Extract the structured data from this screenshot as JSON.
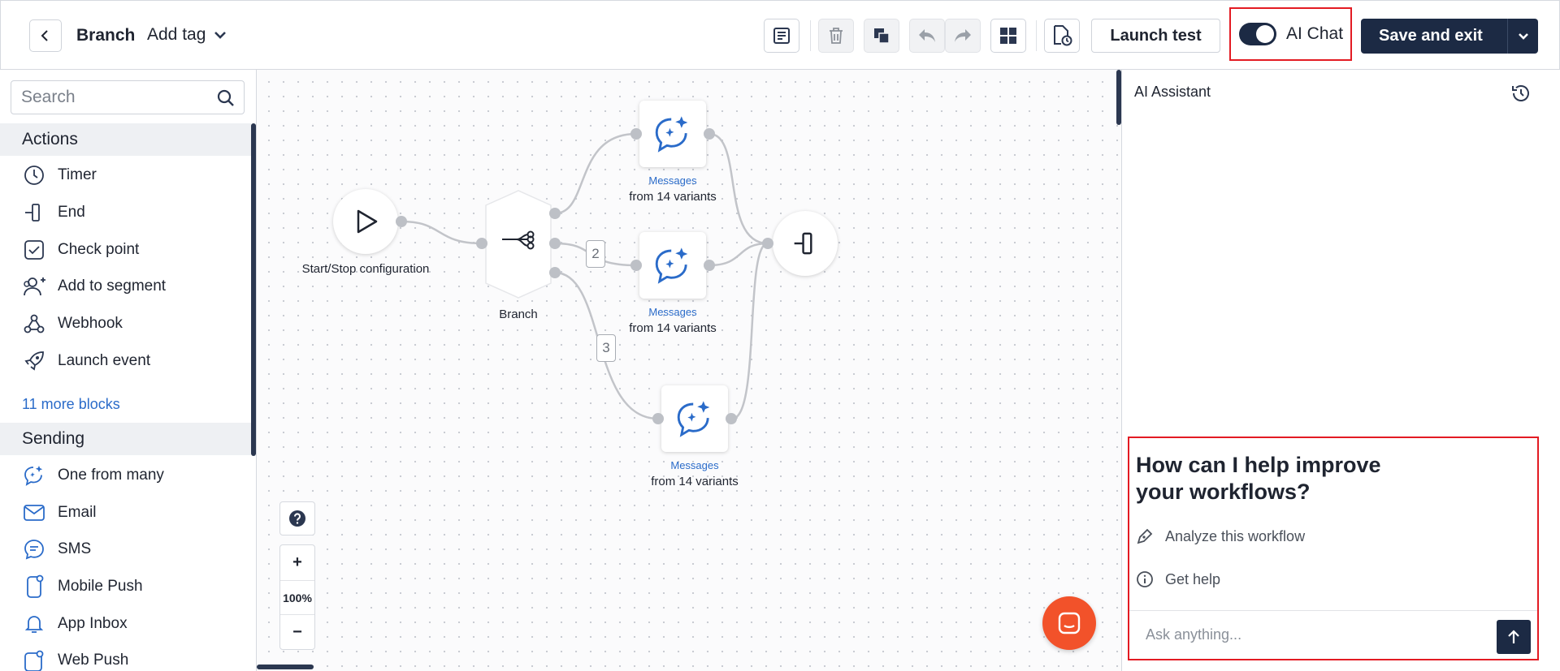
{
  "header": {
    "workflow_name": "Branch",
    "add_tag_label": "Add tag",
    "launch_test_label": "Launch test",
    "ai_chat_label": "AI Chat",
    "save_exit_label": "Save and exit",
    "ai_chat_enabled": true
  },
  "sidebar": {
    "search_placeholder": "Search",
    "sections": [
      {
        "title": "Actions",
        "items": [
          {
            "label": "Timer",
            "icon": "timer-icon"
          },
          {
            "label": "End",
            "icon": "end-icon"
          },
          {
            "label": "Check point",
            "icon": "checkpoint-icon"
          },
          {
            "label": "Add to segment",
            "icon": "add-segment-icon"
          },
          {
            "label": "Webhook",
            "icon": "webhook-icon"
          },
          {
            "label": "Launch event",
            "icon": "launch-event-icon"
          }
        ],
        "more_link": "11 more blocks"
      },
      {
        "title": "Sending",
        "items": [
          {
            "label": "One from many",
            "icon": "sparkle-chat-icon"
          },
          {
            "label": "Email",
            "icon": "email-icon"
          },
          {
            "label": "SMS",
            "icon": "sms-icon"
          },
          {
            "label": "Mobile Push",
            "icon": "mobile-push-icon"
          },
          {
            "label": "App Inbox",
            "icon": "bell-icon"
          },
          {
            "label": "Web Push",
            "icon": "web-push-icon"
          }
        ]
      }
    ]
  },
  "canvas": {
    "nodes": {
      "start": {
        "label": "Start/Stop configuration"
      },
      "branch": {
        "label": "Branch"
      },
      "msg1": {
        "sub": "Messages",
        "label": "from 14 variants"
      },
      "msg2": {
        "sub": "Messages",
        "label": "from 14 variants"
      },
      "msg3": {
        "sub": "Messages",
        "label": "from 14 variants"
      }
    },
    "edge_badges": [
      "2",
      "3"
    ],
    "zoom_level": "100%"
  },
  "assistant": {
    "title": "AI Assistant",
    "heading": "How can I help improve your workflows?",
    "options": [
      "Analyze this workflow",
      "Get help"
    ],
    "input_placeholder": "Ask anything..."
  },
  "colors": {
    "primary": "#1c2a44",
    "link": "#2a6bc9",
    "highlight": "#e31b23",
    "fab": "#f2522a"
  }
}
